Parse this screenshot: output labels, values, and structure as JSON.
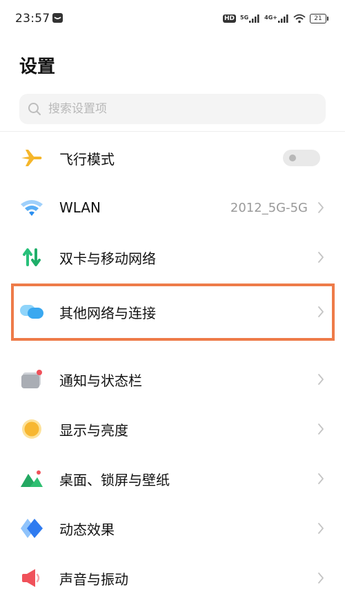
{
  "status_bar": {
    "time": "23:57",
    "hd_label": "HD",
    "sim1_label": "5G",
    "sim2_label": "4G+",
    "battery": "21"
  },
  "page": {
    "title": "设置"
  },
  "search": {
    "placeholder": "搜索设置项"
  },
  "settings": {
    "airplane": {
      "label": "飞行模式",
      "toggle_on": false
    },
    "wlan": {
      "label": "WLAN",
      "value": "2012_5G-5G"
    },
    "dual_sim": {
      "label": "双卡与移动网络"
    },
    "other_network": {
      "label": "其他网络与连接",
      "highlighted": true
    },
    "notification": {
      "label": "通知与状态栏"
    },
    "display": {
      "label": "显示与亮度"
    },
    "wallpaper": {
      "label": "桌面、锁屏与壁纸"
    },
    "animation": {
      "label": "动态效果"
    },
    "sound": {
      "label": "声音与振动"
    }
  },
  "colors": {
    "highlight_border": "#ee7b49",
    "airplane": "#f5b62a",
    "wifi": "#2a8ef0",
    "sim_green": "#28c07a",
    "bubble_blue": "#3aa8f0",
    "display_yellow": "#f7b731",
    "wallpaper_green": "#2fbf72",
    "animation_blue": "#2f7bf0",
    "sound_red": "#f0515a"
  }
}
